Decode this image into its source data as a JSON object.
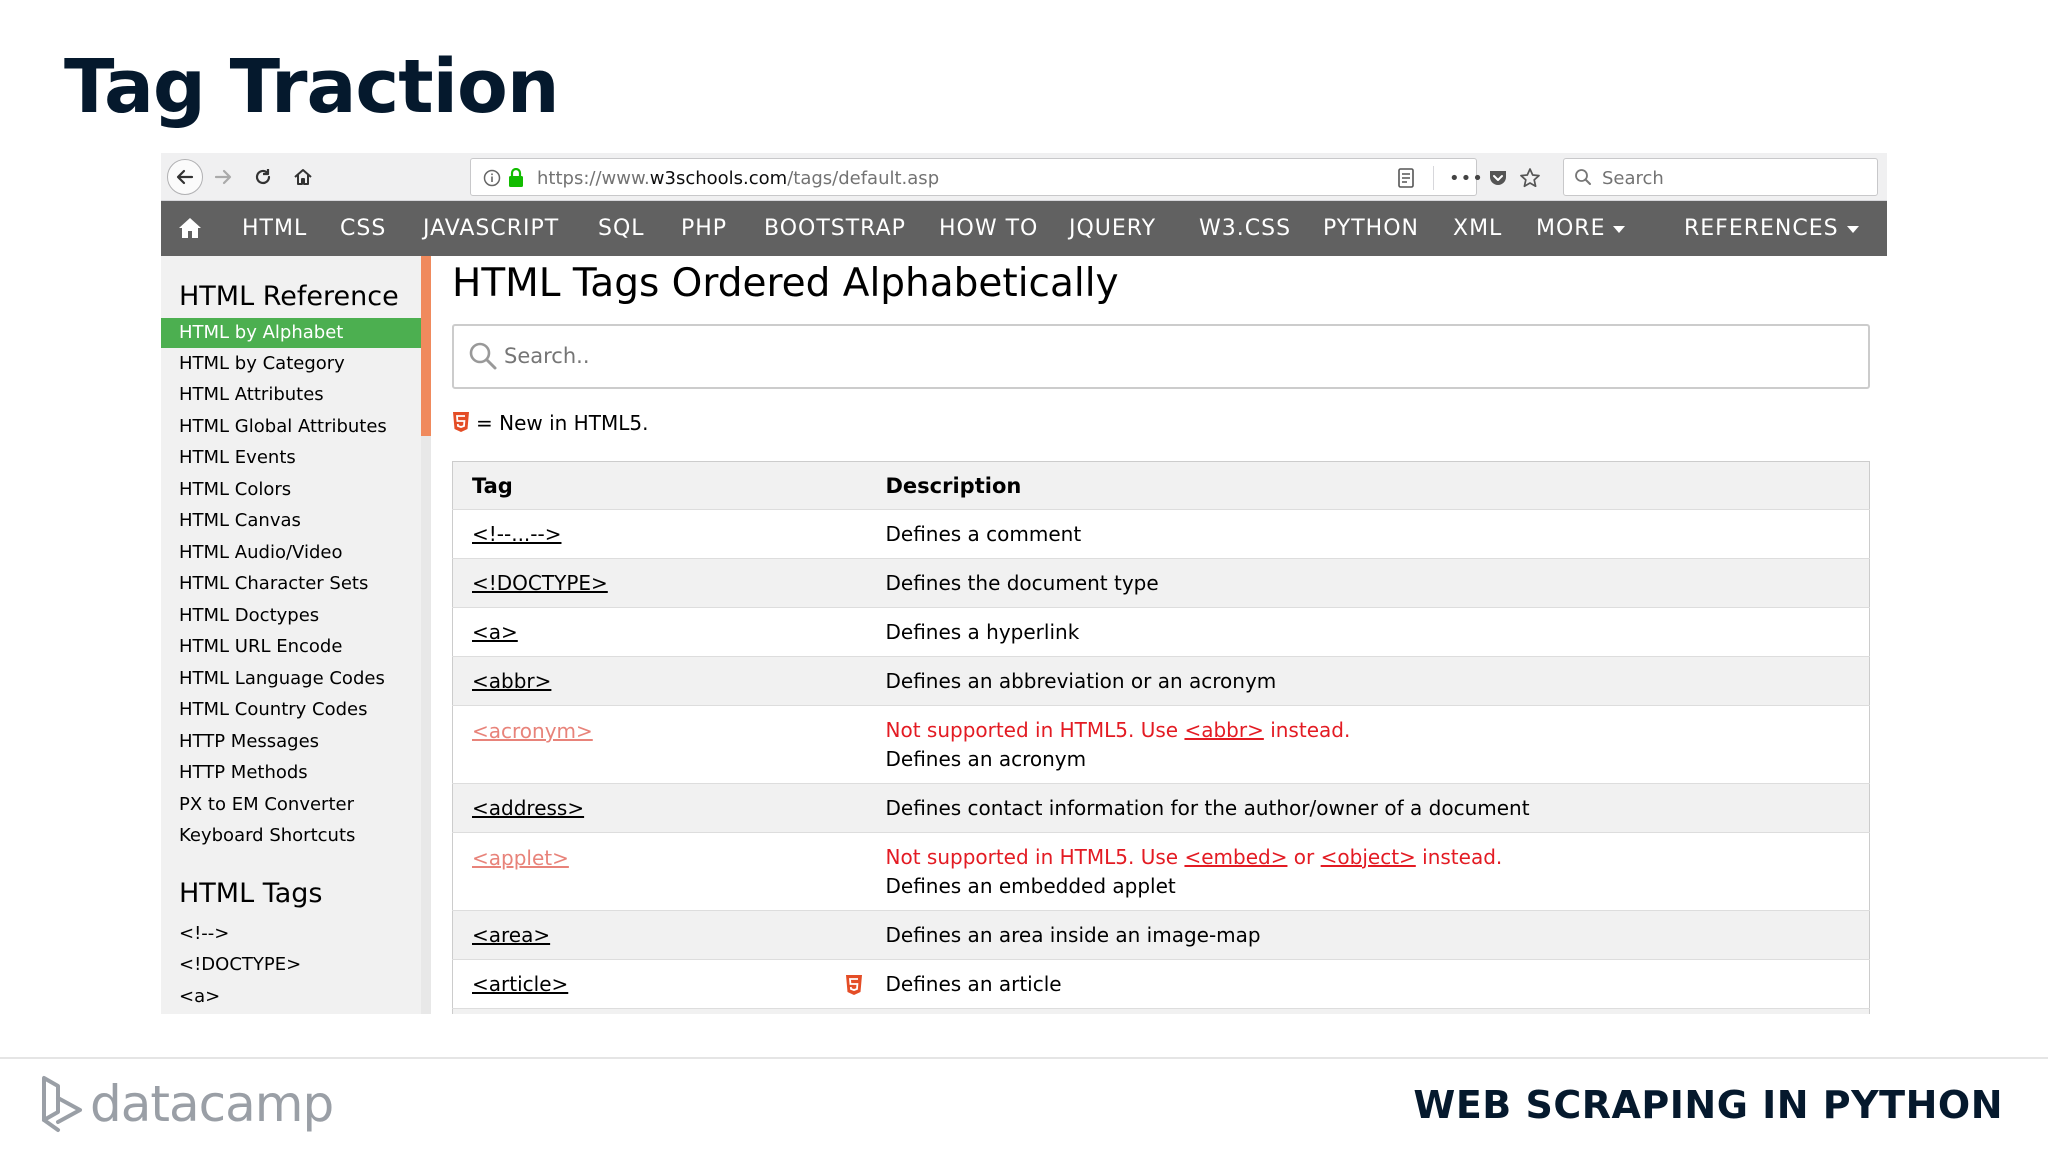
{
  "slide": {
    "title": "Tag Traction",
    "brand": "datacamp",
    "course": "WEB SCRAPING IN PYTHON"
  },
  "browser": {
    "url_prefix": "https://www.",
    "url_domain": "w3schools.com",
    "url_path": "/tags/default.asp",
    "search_placeholder": "Search",
    "menu_dots": "•••"
  },
  "topnav": {
    "items": [
      "HTML",
      "CSS",
      "JAVASCRIPT",
      "SQL",
      "PHP",
      "BOOTSTRAP",
      "HOW TO",
      "JQUERY",
      "W3.CSS",
      "PYTHON",
      "XML",
      "MORE",
      "REFERENCES"
    ]
  },
  "sidebar": {
    "reference_heading": "HTML Reference",
    "reference_links": [
      "HTML by Alphabet",
      "HTML by Category",
      "HTML Attributes",
      "HTML Global Attributes",
      "HTML Events",
      "HTML Colors",
      "HTML Canvas",
      "HTML Audio/Video",
      "HTML Character Sets",
      "HTML Doctypes",
      "HTML URL Encode",
      "HTML Language Codes",
      "HTML Country Codes",
      "HTTP Messages",
      "HTTP Methods",
      "PX to EM Converter",
      "Keyboard Shortcuts"
    ],
    "active_link": "HTML by Alphabet",
    "tags_heading": "HTML Tags",
    "tags_links": [
      "<!-->",
      "<!DOCTYPE>",
      "<a>"
    ]
  },
  "main": {
    "title": "HTML Tags Ordered Alphabetically",
    "search_placeholder": "Search..",
    "legend_text": "= New in HTML5.",
    "table": {
      "headers": [
        "Tag",
        "Description"
      ],
      "rows": [
        {
          "tag": "<!--...-->",
          "desc": "Defines a comment"
        },
        {
          "tag": "<!DOCTYPE>",
          "desc": "Defines the document type"
        },
        {
          "tag": "<a>",
          "desc": "Defines a hyperlink"
        },
        {
          "tag": "<abbr>",
          "desc": "Defines an abbreviation or an acronym"
        },
        {
          "tag": "<acronym>",
          "warn_pre": "Not supported in HTML5. Use ",
          "warn_link1": "<abbr>",
          "warn_post": " instead.",
          "desc": "Defines an acronym"
        },
        {
          "tag": "<address>",
          "desc": "Defines contact information for the author/owner of a document"
        },
        {
          "tag": "<applet>",
          "warn_pre": "Not supported in HTML5. Use ",
          "warn_link1": "<embed>",
          "warn_mid": " or ",
          "warn_link2": "<object>",
          "warn_post": " instead.",
          "desc": "Defines an embedded applet"
        },
        {
          "tag": "<area>",
          "desc": "Defines an area inside an image-map"
        },
        {
          "tag": "<article>",
          "desc": "Defines an article",
          "html5": true
        }
      ]
    }
  },
  "colors": {
    "nav_bg": "#616161",
    "active_green": "#4caf50",
    "deprecated_red": "#e31b23",
    "html5_orange": "#e44d26",
    "scroll_thumb": "#f08a5d"
  }
}
